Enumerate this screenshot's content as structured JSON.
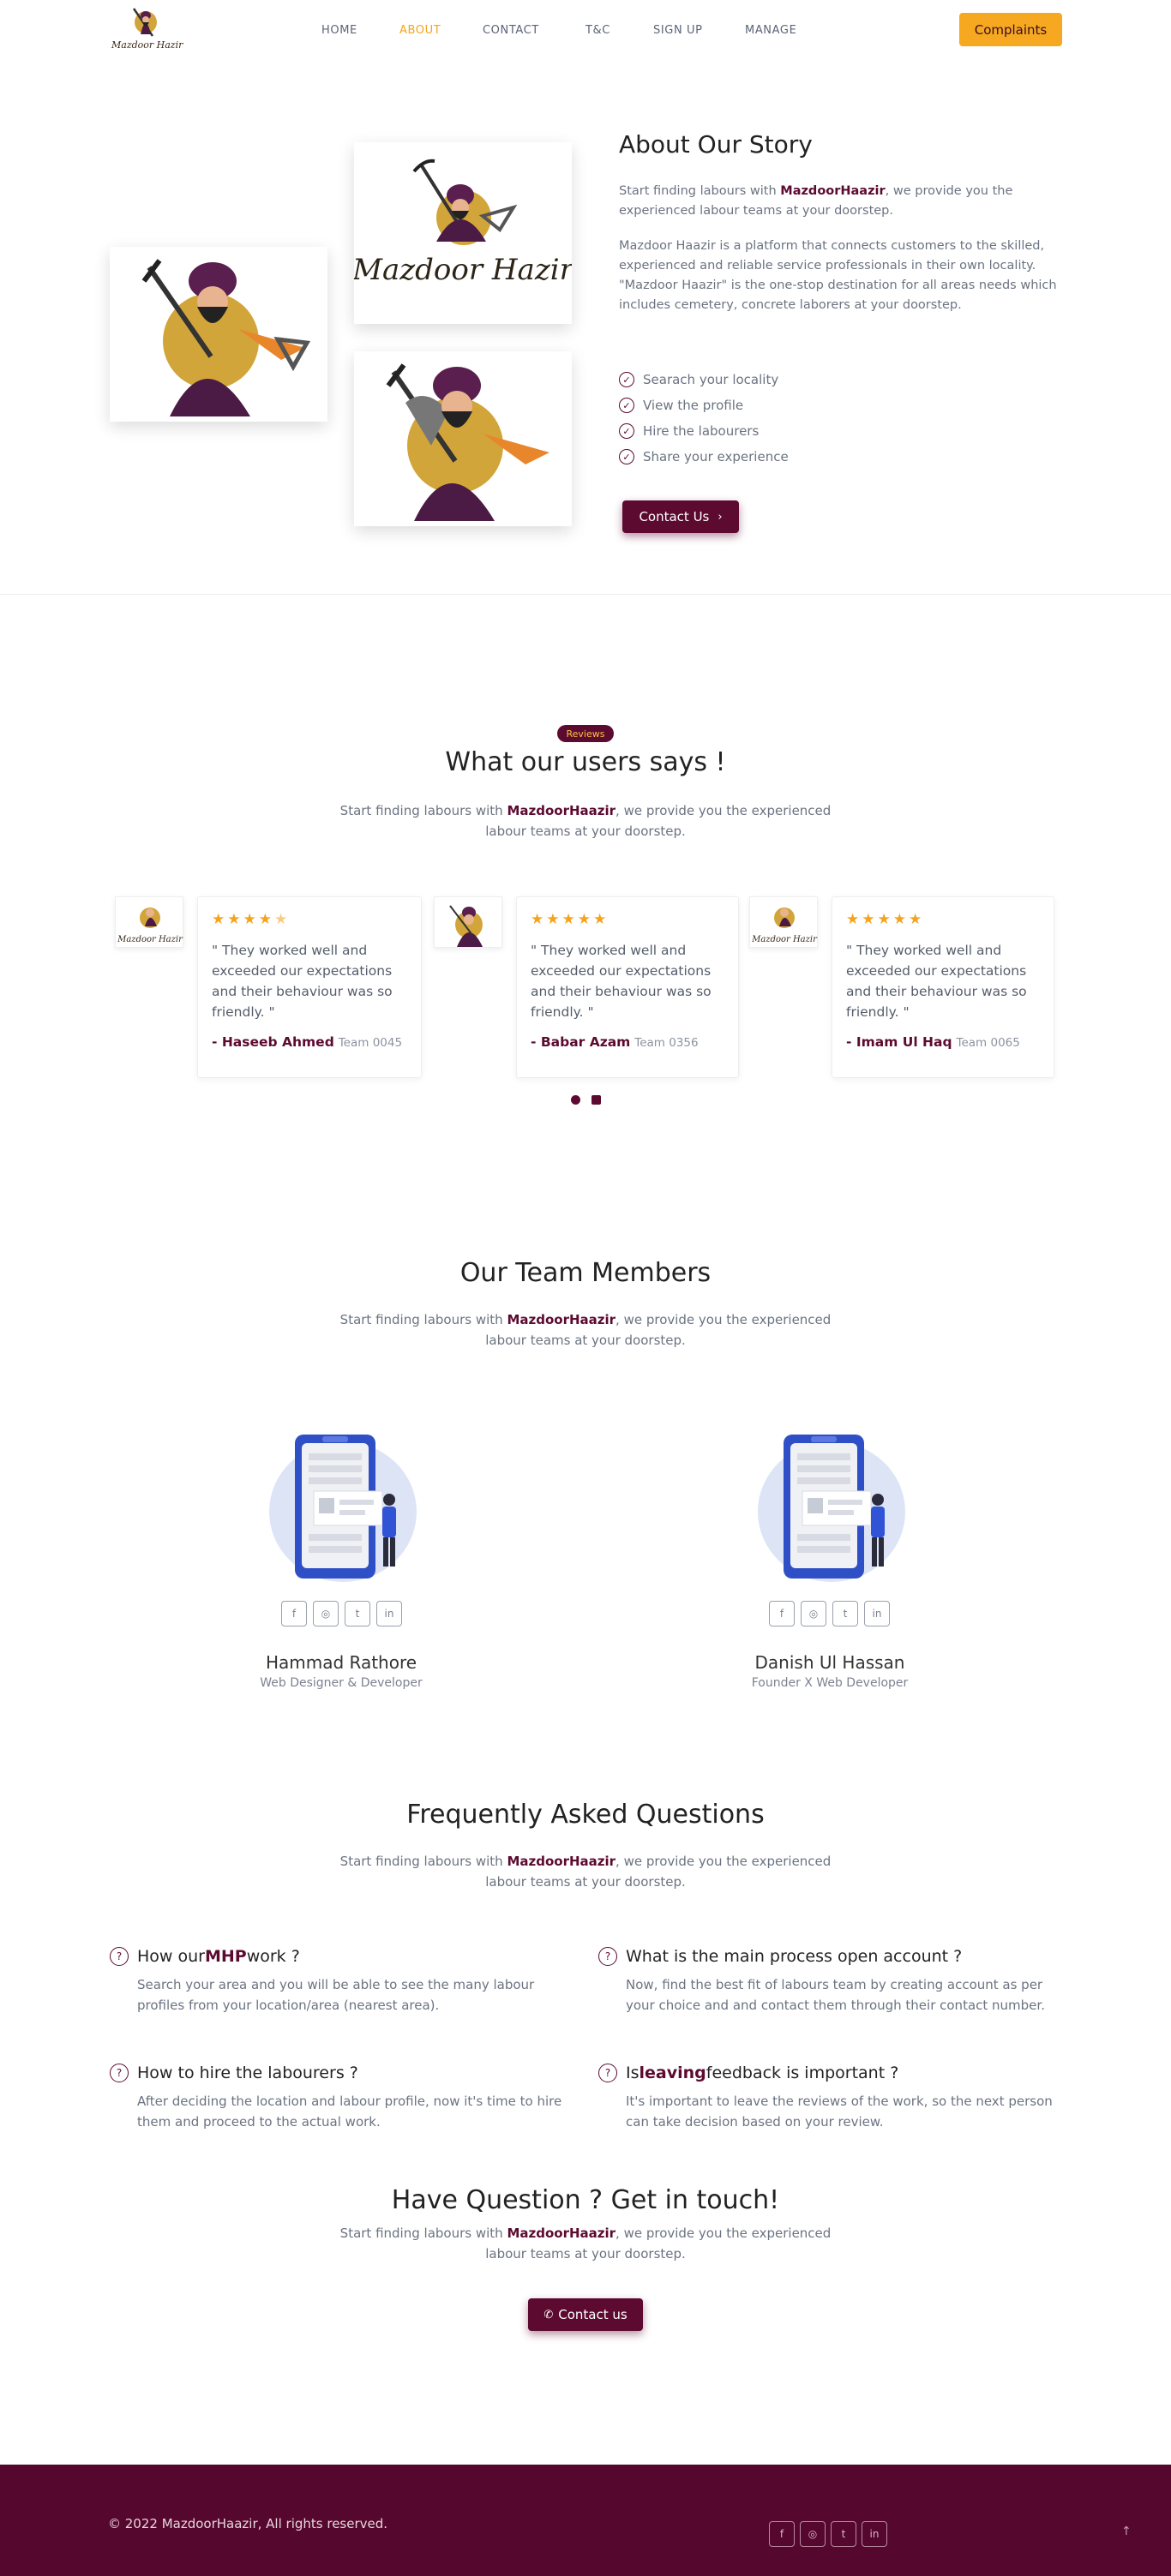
{
  "nav": {
    "logo_text": "Mazdoor Hazir",
    "items": [
      {
        "label": "HOME",
        "active": false
      },
      {
        "label": "ABOUT",
        "active": true
      },
      {
        "label": "CONTACT",
        "active": false
      },
      {
        "label": "T&C",
        "active": false
      },
      {
        "label": "SIGN UP",
        "active": false
      },
      {
        "label": "MANAGE",
        "active": false
      }
    ],
    "cta_label": "Complaints"
  },
  "about": {
    "logo_text": "Mazdoor Hazir",
    "title": "About Our Story",
    "intro_prefix": "Start finding labours with ",
    "brand": "MazdoorHaazir",
    "intro_suffix": ", we provide you the experienced labour teams at your doorstep.",
    "description": "Mazdoor Haazir is a platform that connects customers to the skilled, experienced and reliable service professionals in their own locality. \"Mazdoor Haazir\" is the one-stop destination for all areas needs which includes cemetery, concrete laborers at your doorstep.",
    "features": [
      "Searach your locality",
      "View the profile",
      "Hire the labourers",
      "Share your experience"
    ],
    "button_label": "Contact Us"
  },
  "reviews": {
    "badge": "Reviews",
    "title": "What our users says !",
    "sub_prefix": "Start finding labours with ",
    "brand": "MazdoorHaazir",
    "sub_suffix": ", we provide you the experienced labour teams at your doorstep.",
    "avatar_logo_text": "Mazdoor Hazir",
    "items": [
      {
        "stars": "★★★★",
        "half": "★",
        "rating": 4.5,
        "text": "\" They worked well and exceeded our expectations and their behaviour was so friendly. \"",
        "name": "- Haseeb Ahmed",
        "team": "Team 0045"
      },
      {
        "stars": "★★★★★",
        "half": "",
        "rating": 5,
        "text": "\" They worked well and exceeded our expectations and their behaviour was so friendly. \"",
        "name": "- Babar Azam",
        "team": "Team 0356"
      },
      {
        "stars": "★★★★★",
        "half": "",
        "rating": 5,
        "text": "\" They worked well and exceeded our expectations and their behaviour was so friendly. \"",
        "name": "- Imam Ul Haq",
        "team": "Team 0065"
      }
    ]
  },
  "team": {
    "title": "Our Team Members",
    "sub_prefix": "Start finding labours with ",
    "brand": "MazdoorHaazir",
    "sub_suffix": ", we provide you the experienced labour teams at your doorstep.",
    "social_icons": [
      "facebook-icon",
      "instagram-icon",
      "twitter-icon",
      "linkedin-icon"
    ],
    "members": [
      {
        "name": "Hammad Rathore",
        "role": "Web Designer & Developer"
      },
      {
        "name": "Danish Ul Hassan",
        "role": "Founder X Web Developer"
      }
    ]
  },
  "faq": {
    "title": "Frequently Asked Questions",
    "sub_prefix": "Start finding labours with ",
    "brand": "MazdoorHaazir",
    "sub_suffix": ", we provide you the experienced labour teams at your doorstep.",
    "items": [
      {
        "q_pre": "How our ",
        "q_hl": "MHP",
        "q_post": " work ?",
        "a": "Search your area and you will be able to see the many labour profiles from your location/area (nearest area)."
      },
      {
        "q_pre": "What is the main process open account ?",
        "q_hl": "",
        "q_post": "",
        "a": "Now, find the best fit of labours team by creating account as per your choice and and contact them through their contact number."
      },
      {
        "q_pre": "How to hire the labourers ?",
        "q_hl": "",
        "q_post": "",
        "a": "After deciding the location and labour profile, now it's time to hire them and proceed to the actual work."
      },
      {
        "q_pre": "Is ",
        "q_hl": "leaving",
        "q_post": " feedback is important ?",
        "a": "It's important to leave the reviews of the work, so the next person can take decision based on your review."
      }
    ]
  },
  "contact": {
    "title": "Have Question ? Get in touch!",
    "sub_prefix": "Start finding labours with ",
    "brand": "MazdoorHaazir",
    "sub_suffix": ", we provide you the experienced labour teams at your doorstep.",
    "button_label": "Contact us"
  },
  "footer": {
    "copyright": "© 2022 MazdoorHaazir, All rights reserved."
  },
  "colors": {
    "brand": "#5c0a30",
    "accent": "#f6a821",
    "footer_bg": "#55072d"
  }
}
